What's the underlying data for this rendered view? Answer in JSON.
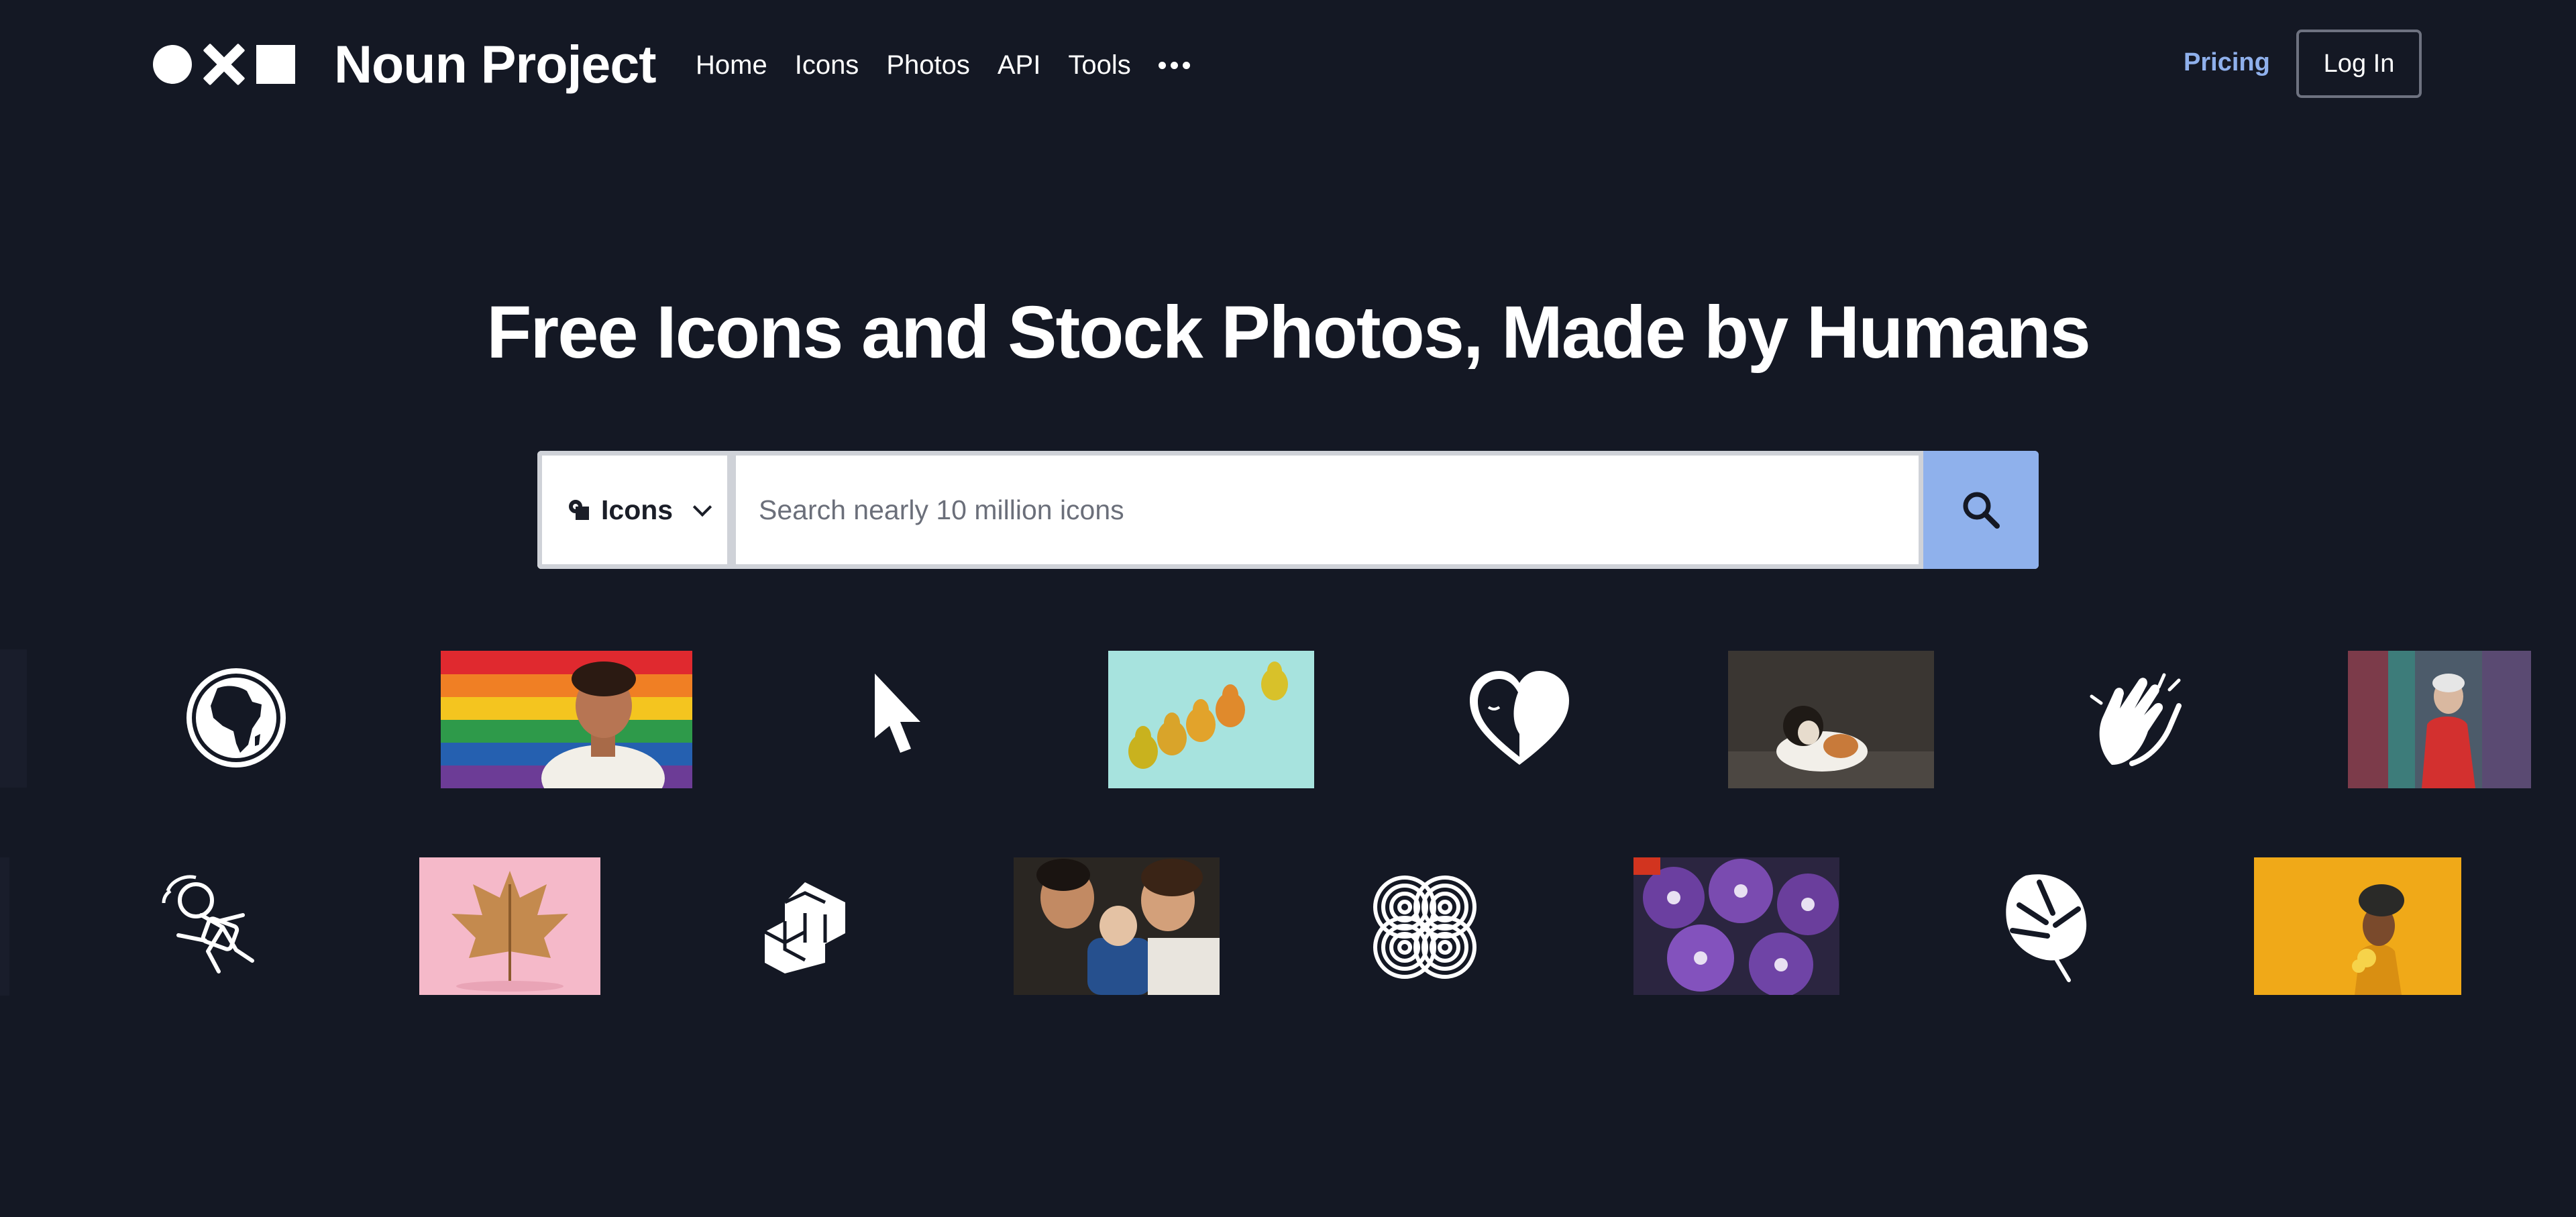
{
  "brand": {
    "name": "Noun Project"
  },
  "nav": {
    "items": [
      {
        "label": "Home"
      },
      {
        "label": "Icons"
      },
      {
        "label": "Photos"
      },
      {
        "label": "API"
      },
      {
        "label": "Tools"
      }
    ],
    "more_icon": "ellipsis-icon"
  },
  "header_actions": {
    "pricing": "Pricing",
    "login": "Log In"
  },
  "hero": {
    "title": "Free Icons and Stock Photos, Made by Humans"
  },
  "search": {
    "type_label": "Icons",
    "placeholder": "Search nearly 10 million icons",
    "value": "",
    "button_icon": "search-icon"
  },
  "colors": {
    "background": "#141824",
    "accent": "#8fb1ec",
    "text": "#ffffff"
  },
  "gallery": {
    "row1": [
      "globe-icon",
      "rainbow-flag-photo",
      "cursor-icon",
      "pears-photo",
      "heart-face-icon",
      "cat-photo",
      "clapping-hands-icon",
      "woman-red-jacket-photo"
    ],
    "row2": [
      "stumbling-person-icon",
      "golden-leaf-photo",
      "blocks-icon",
      "family-baby-photo",
      "knot-pattern-icon",
      "purple-flowers-photo",
      "monstera-leaf-icon",
      "yellow-headwrap-photo"
    ]
  }
}
